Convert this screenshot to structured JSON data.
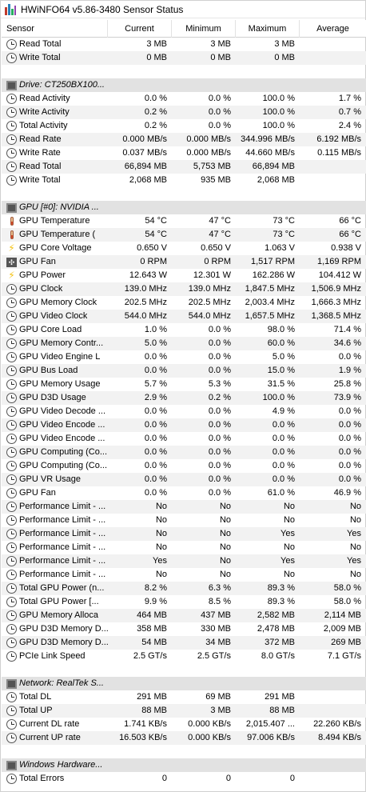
{
  "window": {
    "title": "HWiNFO64 v5.86-3480 Sensor Status"
  },
  "columns": {
    "sensor": "Sensor",
    "current": "Current",
    "minimum": "Minimum",
    "maximum": "Maximum",
    "average": "Average"
  },
  "rows": [
    {
      "kind": "sensor",
      "icon": "clock",
      "name": "Read Total",
      "current": "3 MB",
      "minimum": "3 MB",
      "maximum": "3 MB",
      "average": ""
    },
    {
      "kind": "sensor",
      "icon": "clock",
      "name": "Write Total",
      "current": "0 MB",
      "minimum": "0 MB",
      "maximum": "0 MB",
      "average": ""
    },
    {
      "kind": "blank"
    },
    {
      "kind": "group",
      "icon": "chip",
      "name": "Drive: CT250BX100..."
    },
    {
      "kind": "sensor",
      "icon": "clock",
      "name": "Read Activity",
      "current": "0.0 %",
      "minimum": "0.0 %",
      "maximum": "100.0 %",
      "average": "1.7 %"
    },
    {
      "kind": "sensor",
      "icon": "clock",
      "name": "Write Activity",
      "current": "0.2 %",
      "minimum": "0.0 %",
      "maximum": "100.0 %",
      "average": "0.7 %"
    },
    {
      "kind": "sensor",
      "icon": "clock",
      "name": "Total Activity",
      "current": "0.2 %",
      "minimum": "0.0 %",
      "maximum": "100.0 %",
      "average": "2.4 %"
    },
    {
      "kind": "sensor",
      "icon": "clock",
      "name": "Read Rate",
      "current": "0.000 MB/s",
      "minimum": "0.000 MB/s",
      "maximum": "344.996 MB/s",
      "average": "6.192 MB/s"
    },
    {
      "kind": "sensor",
      "icon": "clock",
      "name": "Write Rate",
      "current": "0.037 MB/s",
      "minimum": "0.000 MB/s",
      "maximum": "44.660 MB/s",
      "average": "0.115 MB/s"
    },
    {
      "kind": "sensor",
      "icon": "clock",
      "name": "Read Total",
      "current": "66,894 MB",
      "minimum": "5,753 MB",
      "maximum": "66,894 MB",
      "average": ""
    },
    {
      "kind": "sensor",
      "icon": "clock",
      "name": "Write Total",
      "current": "2,068 MB",
      "minimum": "935 MB",
      "maximum": "2,068 MB",
      "average": ""
    },
    {
      "kind": "blank"
    },
    {
      "kind": "group",
      "icon": "chip",
      "name": "GPU [#0]: NVIDIA ..."
    },
    {
      "kind": "sensor",
      "icon": "therm",
      "name": "GPU Temperature",
      "current": "54 °C",
      "minimum": "47 °C",
      "maximum": "73 °C",
      "average": "66 °C"
    },
    {
      "kind": "sensor",
      "icon": "therm",
      "name": "GPU Temperature (",
      "current": "54 °C",
      "minimum": "47 °C",
      "maximum": "73 °C",
      "average": "66 °C"
    },
    {
      "kind": "sensor",
      "icon": "bolt",
      "name": "GPU Core Voltage",
      "current": "0.650 V",
      "minimum": "0.650 V",
      "maximum": "1.063 V",
      "average": "0.938 V"
    },
    {
      "kind": "sensor",
      "icon": "fan",
      "name": "GPU Fan",
      "current": "0 RPM",
      "minimum": "0 RPM",
      "maximum": "1,517 RPM",
      "average": "1,169 RPM"
    },
    {
      "kind": "sensor",
      "icon": "bolt",
      "name": "GPU Power",
      "current": "12.643 W",
      "minimum": "12.301 W",
      "maximum": "162.286 W",
      "average": "104.412 W"
    },
    {
      "kind": "sensor",
      "icon": "clock",
      "name": "GPU Clock",
      "current": "139.0 MHz",
      "minimum": "139.0 MHz",
      "maximum": "1,847.5 MHz",
      "average": "1,506.9 MHz"
    },
    {
      "kind": "sensor",
      "icon": "clock",
      "name": "GPU Memory Clock",
      "current": "202.5 MHz",
      "minimum": "202.5 MHz",
      "maximum": "2,003.4 MHz",
      "average": "1,666.3 MHz"
    },
    {
      "kind": "sensor",
      "icon": "clock",
      "name": "GPU Video Clock",
      "current": "544.0 MHz",
      "minimum": "544.0 MHz",
      "maximum": "1,657.5 MHz",
      "average": "1,368.5 MHz"
    },
    {
      "kind": "sensor",
      "icon": "clock",
      "name": "GPU Core Load",
      "current": "1.0 %",
      "minimum": "0.0 %",
      "maximum": "98.0 %",
      "average": "71.4 %"
    },
    {
      "kind": "sensor",
      "icon": "clock",
      "name": "GPU Memory Contr...",
      "current": "5.0 %",
      "minimum": "0.0 %",
      "maximum": "60.0 %",
      "average": "34.6 %"
    },
    {
      "kind": "sensor",
      "icon": "clock",
      "name": "GPU Video Engine L",
      "current": "0.0 %",
      "minimum": "0.0 %",
      "maximum": "5.0 %",
      "average": "0.0 %"
    },
    {
      "kind": "sensor",
      "icon": "clock",
      "name": "GPU Bus Load",
      "current": "0.0 %",
      "minimum": "0.0 %",
      "maximum": "15.0 %",
      "average": "1.9 %"
    },
    {
      "kind": "sensor",
      "icon": "clock",
      "name": "GPU Memory Usage",
      "current": "5.7 %",
      "minimum": "5.3 %",
      "maximum": "31.5 %",
      "average": "25.8 %"
    },
    {
      "kind": "sensor",
      "icon": "clock",
      "name": "GPU D3D Usage",
      "current": "2.9 %",
      "minimum": "0.2 %",
      "maximum": "100.0 %",
      "average": "73.9 %"
    },
    {
      "kind": "sensor",
      "icon": "clock",
      "name": "GPU Video Decode ...",
      "current": "0.0 %",
      "minimum": "0.0 %",
      "maximum": "4.9 %",
      "average": "0.0 %"
    },
    {
      "kind": "sensor",
      "icon": "clock",
      "name": "GPU Video Encode ...",
      "current": "0.0 %",
      "minimum": "0.0 %",
      "maximum": "0.0 %",
      "average": "0.0 %"
    },
    {
      "kind": "sensor",
      "icon": "clock",
      "name": "GPU Video Encode ...",
      "current": "0.0 %",
      "minimum": "0.0 %",
      "maximum": "0.0 %",
      "average": "0.0 %"
    },
    {
      "kind": "sensor",
      "icon": "clock",
      "name": "GPU Computing (Co...",
      "current": "0.0 %",
      "minimum": "0.0 %",
      "maximum": "0.0 %",
      "average": "0.0 %"
    },
    {
      "kind": "sensor",
      "icon": "clock",
      "name": "GPU Computing (Co...",
      "current": "0.0 %",
      "minimum": "0.0 %",
      "maximum": "0.0 %",
      "average": "0.0 %"
    },
    {
      "kind": "sensor",
      "icon": "clock",
      "name": "GPU VR Usage",
      "current": "0.0 %",
      "minimum": "0.0 %",
      "maximum": "0.0 %",
      "average": "0.0 %"
    },
    {
      "kind": "sensor",
      "icon": "clock",
      "name": "GPU Fan",
      "current": "0.0 %",
      "minimum": "0.0 %",
      "maximum": "61.0 %",
      "average": "46.9 %"
    },
    {
      "kind": "sensor",
      "icon": "clock",
      "name": "Performance Limit - ...",
      "current": "No",
      "minimum": "No",
      "maximum": "No",
      "average": "No"
    },
    {
      "kind": "sensor",
      "icon": "clock",
      "name": "Performance Limit - ...",
      "current": "No",
      "minimum": "No",
      "maximum": "No",
      "average": "No"
    },
    {
      "kind": "sensor",
      "icon": "clock",
      "name": "Performance Limit - ...",
      "current": "No",
      "minimum": "No",
      "maximum": "Yes",
      "average": "Yes"
    },
    {
      "kind": "sensor",
      "icon": "clock",
      "name": "Performance Limit - ...",
      "current": "No",
      "minimum": "No",
      "maximum": "No",
      "average": "No"
    },
    {
      "kind": "sensor",
      "icon": "clock",
      "name": "Performance Limit - ...",
      "current": "Yes",
      "minimum": "No",
      "maximum": "Yes",
      "average": "Yes"
    },
    {
      "kind": "sensor",
      "icon": "clock",
      "name": "Performance Limit - ...",
      "current": "No",
      "minimum": "No",
      "maximum": "No",
      "average": "No"
    },
    {
      "kind": "sensor",
      "icon": "clock",
      "name": "Total GPU Power (n...",
      "current": "8.2 %",
      "minimum": "6.3 %",
      "maximum": "89.3 %",
      "average": "58.0 %"
    },
    {
      "kind": "sensor",
      "icon": "clock",
      "name": "Total GPU Power [...",
      "current": "9.9 %",
      "minimum": "8.5 %",
      "maximum": "89.3 %",
      "average": "58.0 %"
    },
    {
      "kind": "sensor",
      "icon": "clock",
      "name": "GPU Memory Alloca",
      "current": "464 MB",
      "minimum": "437 MB",
      "maximum": "2,582 MB",
      "average": "2,114 MB"
    },
    {
      "kind": "sensor",
      "icon": "clock",
      "name": "GPU D3D Memory D...",
      "current": "358 MB",
      "minimum": "330 MB",
      "maximum": "2,478 MB",
      "average": "2,009 MB"
    },
    {
      "kind": "sensor",
      "icon": "clock",
      "name": "GPU D3D Memory D...",
      "current": "54 MB",
      "minimum": "34 MB",
      "maximum": "372 MB",
      "average": "269 MB"
    },
    {
      "kind": "sensor",
      "icon": "clock",
      "name": "PCIe Link Speed",
      "current": "2.5 GT/s",
      "minimum": "2.5 GT/s",
      "maximum": "8.0 GT/s",
      "average": "7.1 GT/s"
    },
    {
      "kind": "blank"
    },
    {
      "kind": "group",
      "icon": "chip",
      "name": "Network: RealTek S..."
    },
    {
      "kind": "sensor",
      "icon": "clock",
      "name": "Total DL",
      "current": "291 MB",
      "minimum": "69 MB",
      "maximum": "291 MB",
      "average": ""
    },
    {
      "kind": "sensor",
      "icon": "clock",
      "name": "Total UP",
      "current": "88 MB",
      "minimum": "3 MB",
      "maximum": "88 MB",
      "average": ""
    },
    {
      "kind": "sensor",
      "icon": "clock",
      "name": "Current DL rate",
      "current": "1.741 KB/s",
      "minimum": "0.000 KB/s",
      "maximum": "2,015.407 ...",
      "average": "22.260 KB/s"
    },
    {
      "kind": "sensor",
      "icon": "clock",
      "name": "Current UP rate",
      "current": "16.503 KB/s",
      "minimum": "0.000 KB/s",
      "maximum": "97.006 KB/s",
      "average": "8.494 KB/s"
    },
    {
      "kind": "blank"
    },
    {
      "kind": "group",
      "icon": "chip",
      "name": "Windows Hardware..."
    },
    {
      "kind": "sensor",
      "icon": "clock",
      "name": "Total Errors",
      "current": "0",
      "minimum": "0",
      "maximum": "0",
      "average": ""
    }
  ]
}
